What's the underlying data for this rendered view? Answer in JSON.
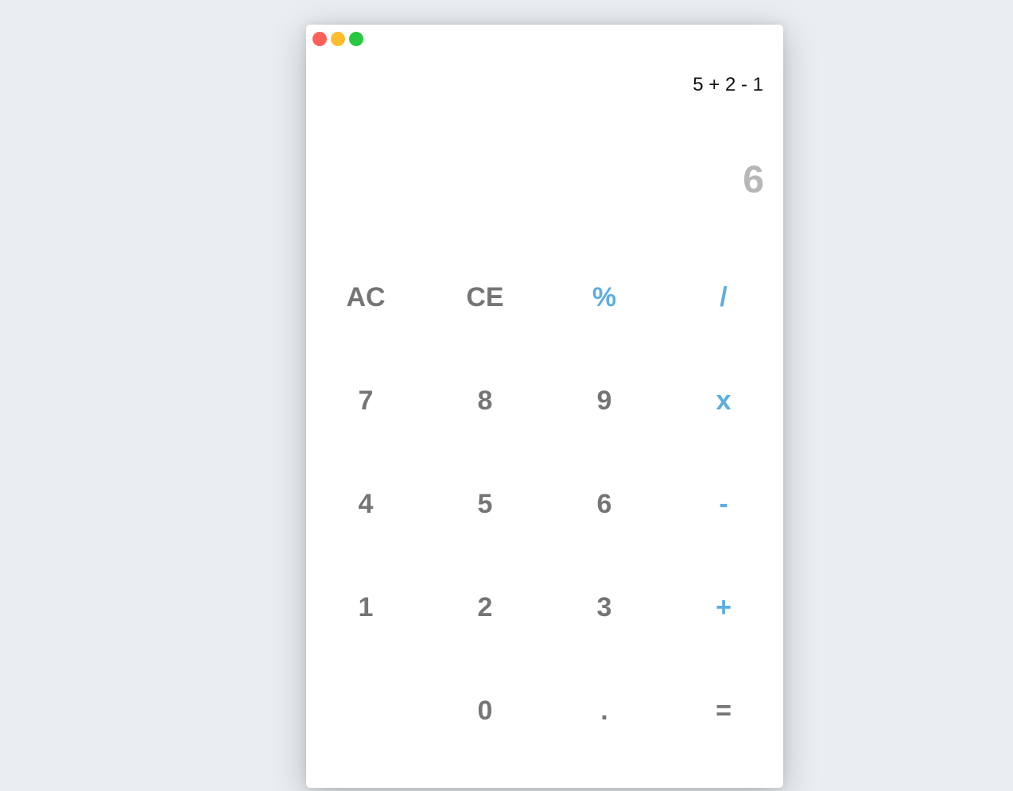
{
  "window": {
    "controls": [
      {
        "name": "close",
        "color": "#fe5f57"
      },
      {
        "name": "minimize",
        "color": "#febc2e"
      },
      {
        "name": "maximize",
        "color": "#28c840"
      }
    ]
  },
  "display": {
    "expression": "5 + 2 - 1",
    "result": "6"
  },
  "keypad": {
    "accent_color": "#5dade2",
    "digit_color": "#757575",
    "keys": [
      {
        "label": "AC",
        "type": "function"
      },
      {
        "label": "CE",
        "type": "function"
      },
      {
        "label": "%",
        "type": "operator"
      },
      {
        "label": "/",
        "type": "operator"
      },
      {
        "label": "7",
        "type": "digit"
      },
      {
        "label": "8",
        "type": "digit"
      },
      {
        "label": "9",
        "type": "digit"
      },
      {
        "label": "x",
        "type": "operator"
      },
      {
        "label": "4",
        "type": "digit"
      },
      {
        "label": "5",
        "type": "digit"
      },
      {
        "label": "6",
        "type": "digit"
      },
      {
        "label": "-",
        "type": "operator"
      },
      {
        "label": "1",
        "type": "digit"
      },
      {
        "label": "2",
        "type": "digit"
      },
      {
        "label": "3",
        "type": "digit"
      },
      {
        "label": "+",
        "type": "operator"
      },
      {
        "label": "",
        "type": "empty"
      },
      {
        "label": "0",
        "type": "digit"
      },
      {
        "label": ".",
        "type": "digit"
      },
      {
        "label": "=",
        "type": "equals"
      }
    ]
  }
}
